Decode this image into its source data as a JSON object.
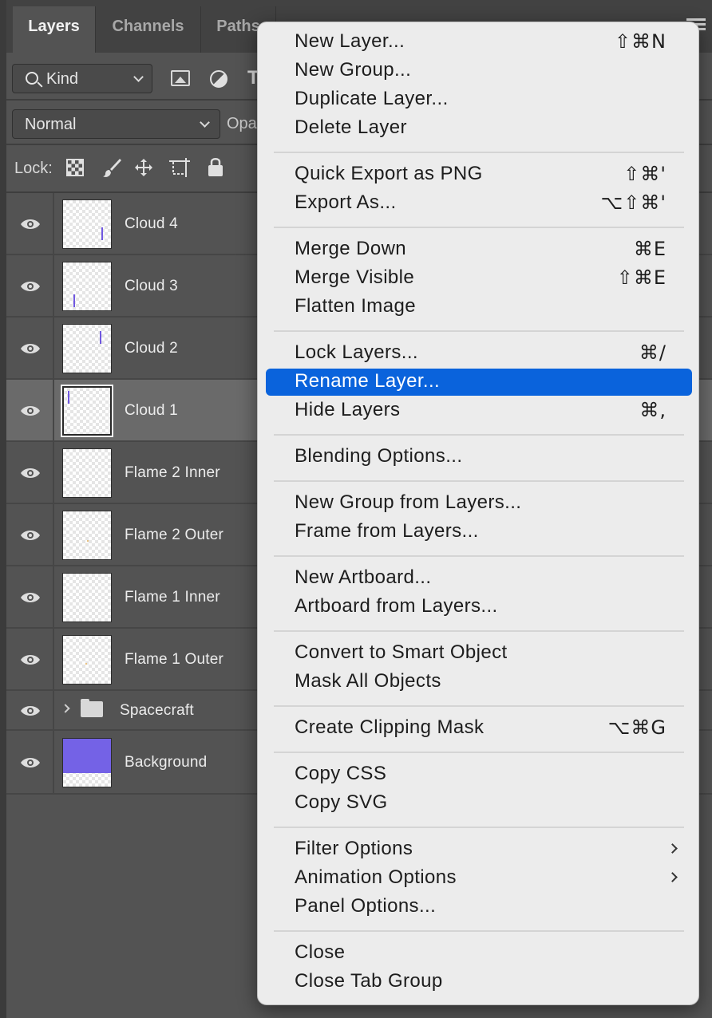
{
  "panel": {
    "tabs": [
      {
        "label": "Layers",
        "active": true
      },
      {
        "label": "Channels",
        "active": false
      },
      {
        "label": "Paths",
        "active": false
      }
    ],
    "filter": {
      "kind_label": "Kind"
    },
    "blend_mode": "Normal",
    "opacity_label": "Opa",
    "lock_label": "Lock:",
    "layers": [
      {
        "name": "Cloud 4",
        "visible": true,
        "selected": false,
        "type": "layer"
      },
      {
        "name": "Cloud 3",
        "visible": true,
        "selected": false,
        "type": "layer"
      },
      {
        "name": "Cloud 2",
        "visible": true,
        "selected": false,
        "type": "layer"
      },
      {
        "name": "Cloud 1",
        "visible": true,
        "selected": true,
        "type": "layer"
      },
      {
        "name": "Flame 2 Inner",
        "visible": true,
        "selected": false,
        "type": "layer"
      },
      {
        "name": "Flame 2 Outer",
        "visible": true,
        "selected": false,
        "type": "layer"
      },
      {
        "name": "Flame 1 Inner",
        "visible": true,
        "selected": false,
        "type": "layer"
      },
      {
        "name": "Flame 1 Outer",
        "visible": true,
        "selected": false,
        "type": "layer"
      },
      {
        "name": "Spacecraft",
        "visible": true,
        "selected": false,
        "type": "group"
      },
      {
        "name": "Background",
        "visible": true,
        "selected": false,
        "type": "layer"
      }
    ]
  },
  "menu": {
    "highlight_color": "#0a63dc",
    "groups": [
      [
        {
          "label": "New Layer...",
          "shortcut": "⇧⌘N"
        },
        {
          "label": "New Group...",
          "shortcut": ""
        },
        {
          "label": "Duplicate Layer...",
          "shortcut": ""
        },
        {
          "label": "Delete Layer",
          "shortcut": ""
        }
      ],
      [
        {
          "label": "Quick Export as PNG",
          "shortcut": "⇧⌘'"
        },
        {
          "label": "Export As...",
          "shortcut": "⌥⇧⌘'"
        }
      ],
      [
        {
          "label": "Merge Down",
          "shortcut": "⌘E"
        },
        {
          "label": "Merge Visible",
          "shortcut": "⇧⌘E"
        },
        {
          "label": "Flatten Image",
          "shortcut": ""
        }
      ],
      [
        {
          "label": "Lock Layers...",
          "shortcut": "⌘/"
        },
        {
          "label": "Rename Layer...",
          "shortcut": "",
          "highlighted": true
        },
        {
          "label": "Hide Layers",
          "shortcut": "⌘,"
        }
      ],
      [
        {
          "label": "Blending Options...",
          "shortcut": ""
        }
      ],
      [
        {
          "label": "New Group from Layers...",
          "shortcut": ""
        },
        {
          "label": "Frame from Layers...",
          "shortcut": ""
        }
      ],
      [
        {
          "label": "New Artboard...",
          "shortcut": ""
        },
        {
          "label": "Artboard from Layers...",
          "shortcut": ""
        }
      ],
      [
        {
          "label": "Convert to Smart Object",
          "shortcut": ""
        },
        {
          "label": "Mask All Objects",
          "shortcut": ""
        }
      ],
      [
        {
          "label": "Create Clipping Mask",
          "shortcut": "⌥⌘G"
        }
      ],
      [
        {
          "label": "Copy CSS",
          "shortcut": ""
        },
        {
          "label": "Copy SVG",
          "shortcut": ""
        }
      ],
      [
        {
          "label": "Filter Options",
          "shortcut": "",
          "submenu": true
        },
        {
          "label": "Animation Options",
          "shortcut": "",
          "submenu": true
        },
        {
          "label": "Panel Options...",
          "shortcut": ""
        }
      ],
      [
        {
          "label": "Close",
          "shortcut": ""
        },
        {
          "label": "Close Tab Group",
          "shortcut": ""
        }
      ]
    ]
  }
}
